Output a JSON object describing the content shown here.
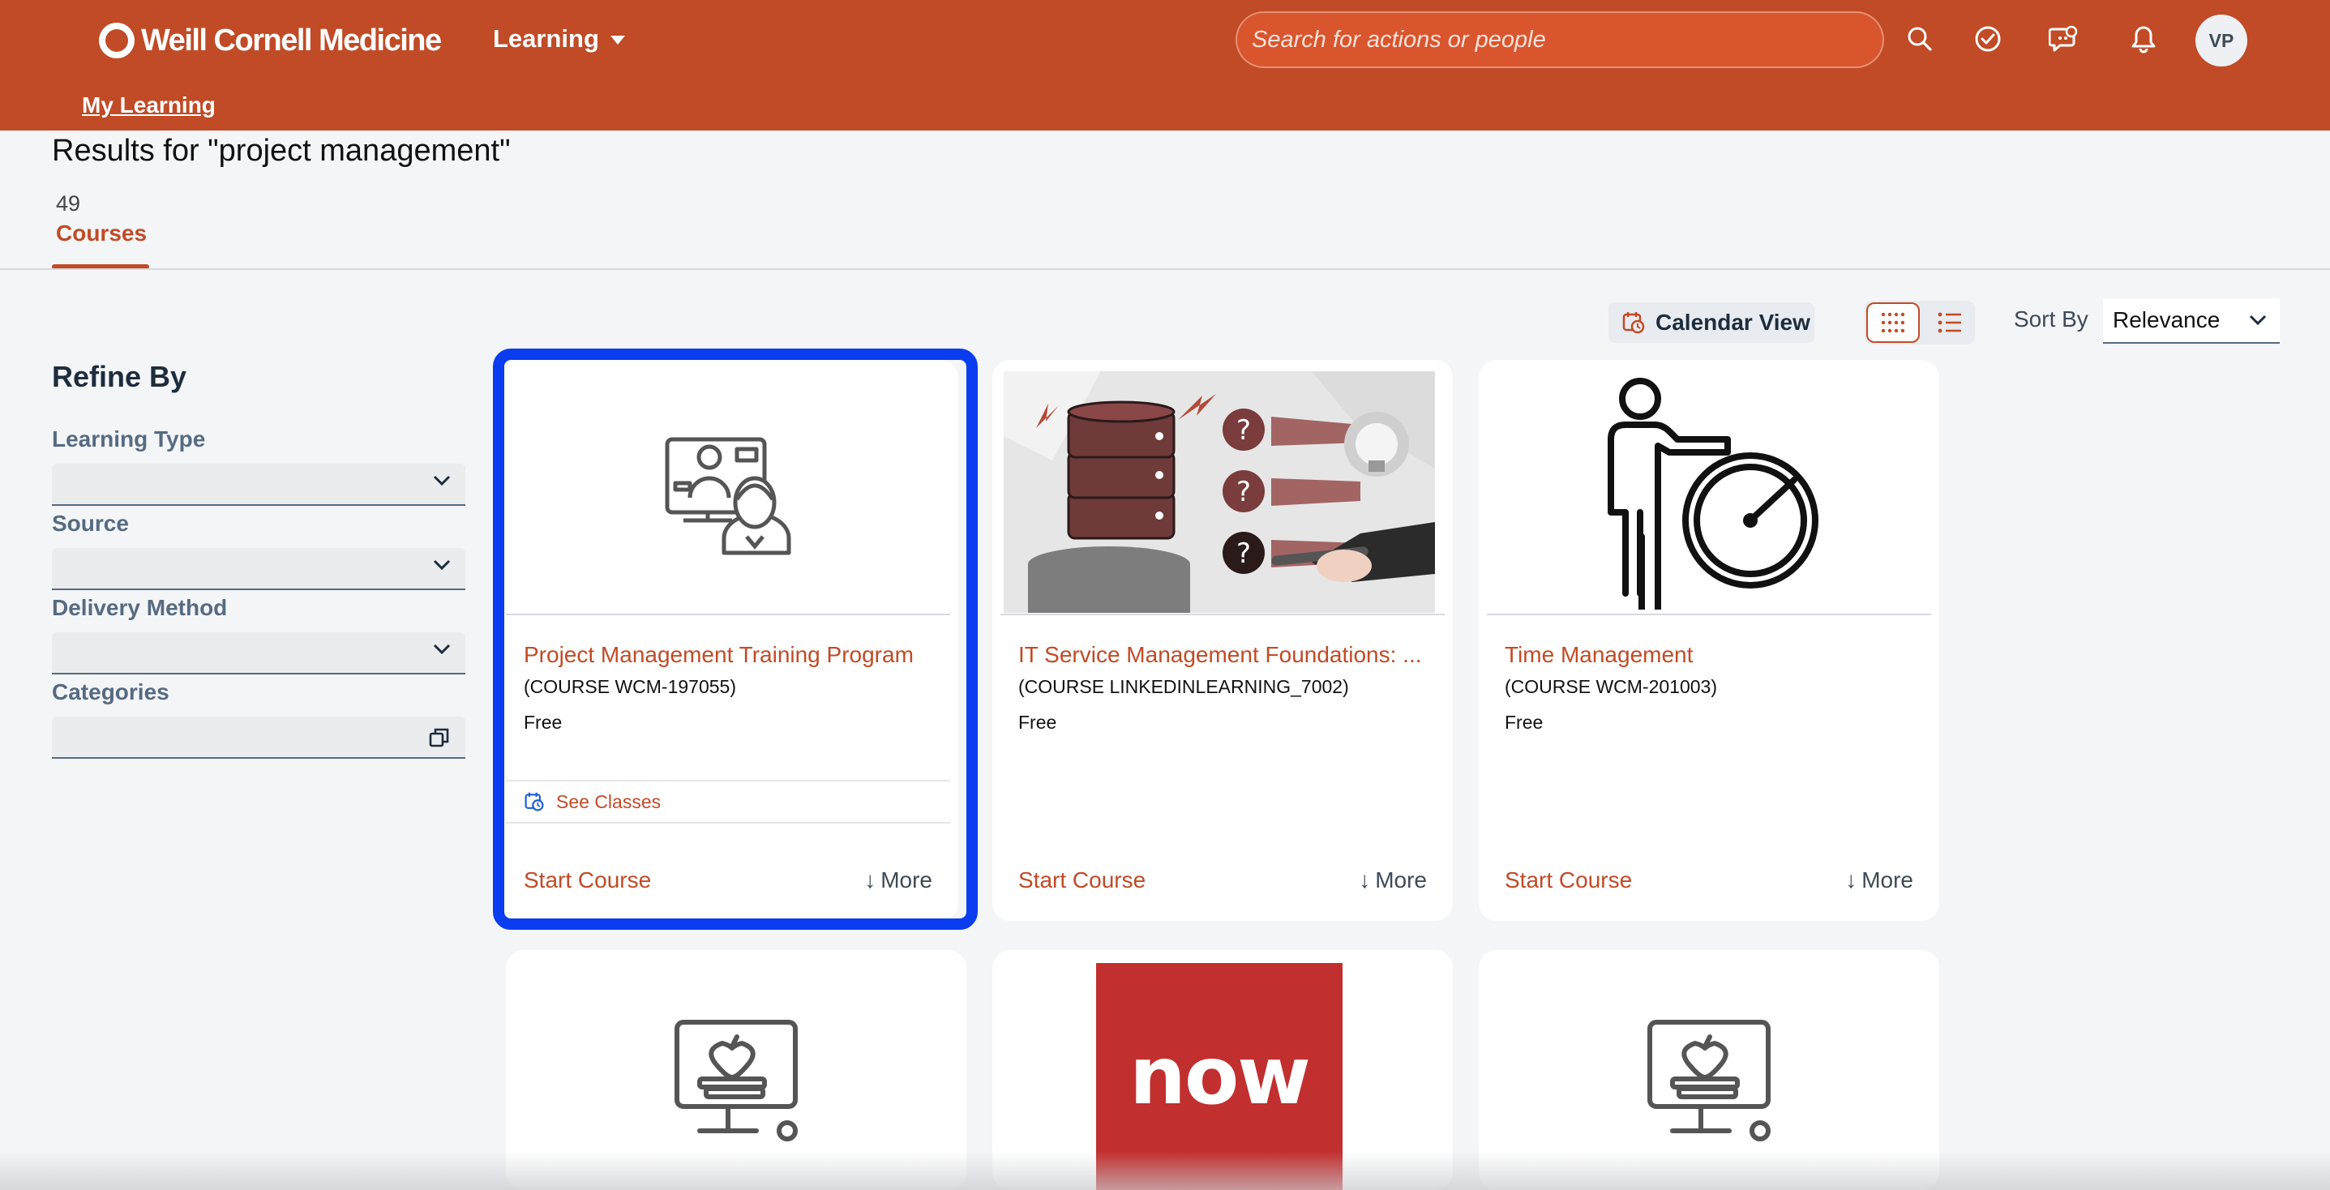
{
  "header": {
    "brand": "Weill Cornell Medicine",
    "menu_label": "Learning",
    "search_placeholder": "Search for actions or people",
    "avatar_initials": "VP",
    "sub_nav_link": "My Learning",
    "brand_color": "#c04b26"
  },
  "results": {
    "title": "Results for \"project management\"",
    "tab_count": "49",
    "tab_label": "Courses"
  },
  "toolbar": {
    "calendar_view_label": "Calendar View",
    "sort_by_label": "Sort By",
    "sort_value": "Relevance"
  },
  "sidebar": {
    "title": "Refine By",
    "filters": [
      {
        "label": "Learning Type"
      },
      {
        "label": "Source"
      },
      {
        "label": "Delivery Method"
      },
      {
        "label": "Categories"
      }
    ]
  },
  "cards": [
    {
      "title": "Project Management Training Program",
      "code": "(COURSE WCM-197055)",
      "price": "Free",
      "classes_label": "See Classes",
      "start_label": "Start Course",
      "more_label": "More",
      "image": "online-training-icon",
      "selected": true
    },
    {
      "title": "IT Service Management Foundations: ...",
      "code": "(COURSE LINKEDINLEARNING_7002)",
      "price": "Free",
      "start_label": "Start Course",
      "more_label": "More",
      "image": "database-illustration"
    },
    {
      "title": "Time Management",
      "code": "(COURSE WCM-201003)",
      "price": "Free",
      "start_label": "Start Course",
      "more_label": "More",
      "image": "presenter-gauge-icon"
    },
    {
      "image": "computer-apple-icon"
    },
    {
      "image": "now-logo",
      "logo_text": "now"
    },
    {
      "image": "computer-apple-icon"
    }
  ],
  "accent_blue": "#0a3cf0"
}
